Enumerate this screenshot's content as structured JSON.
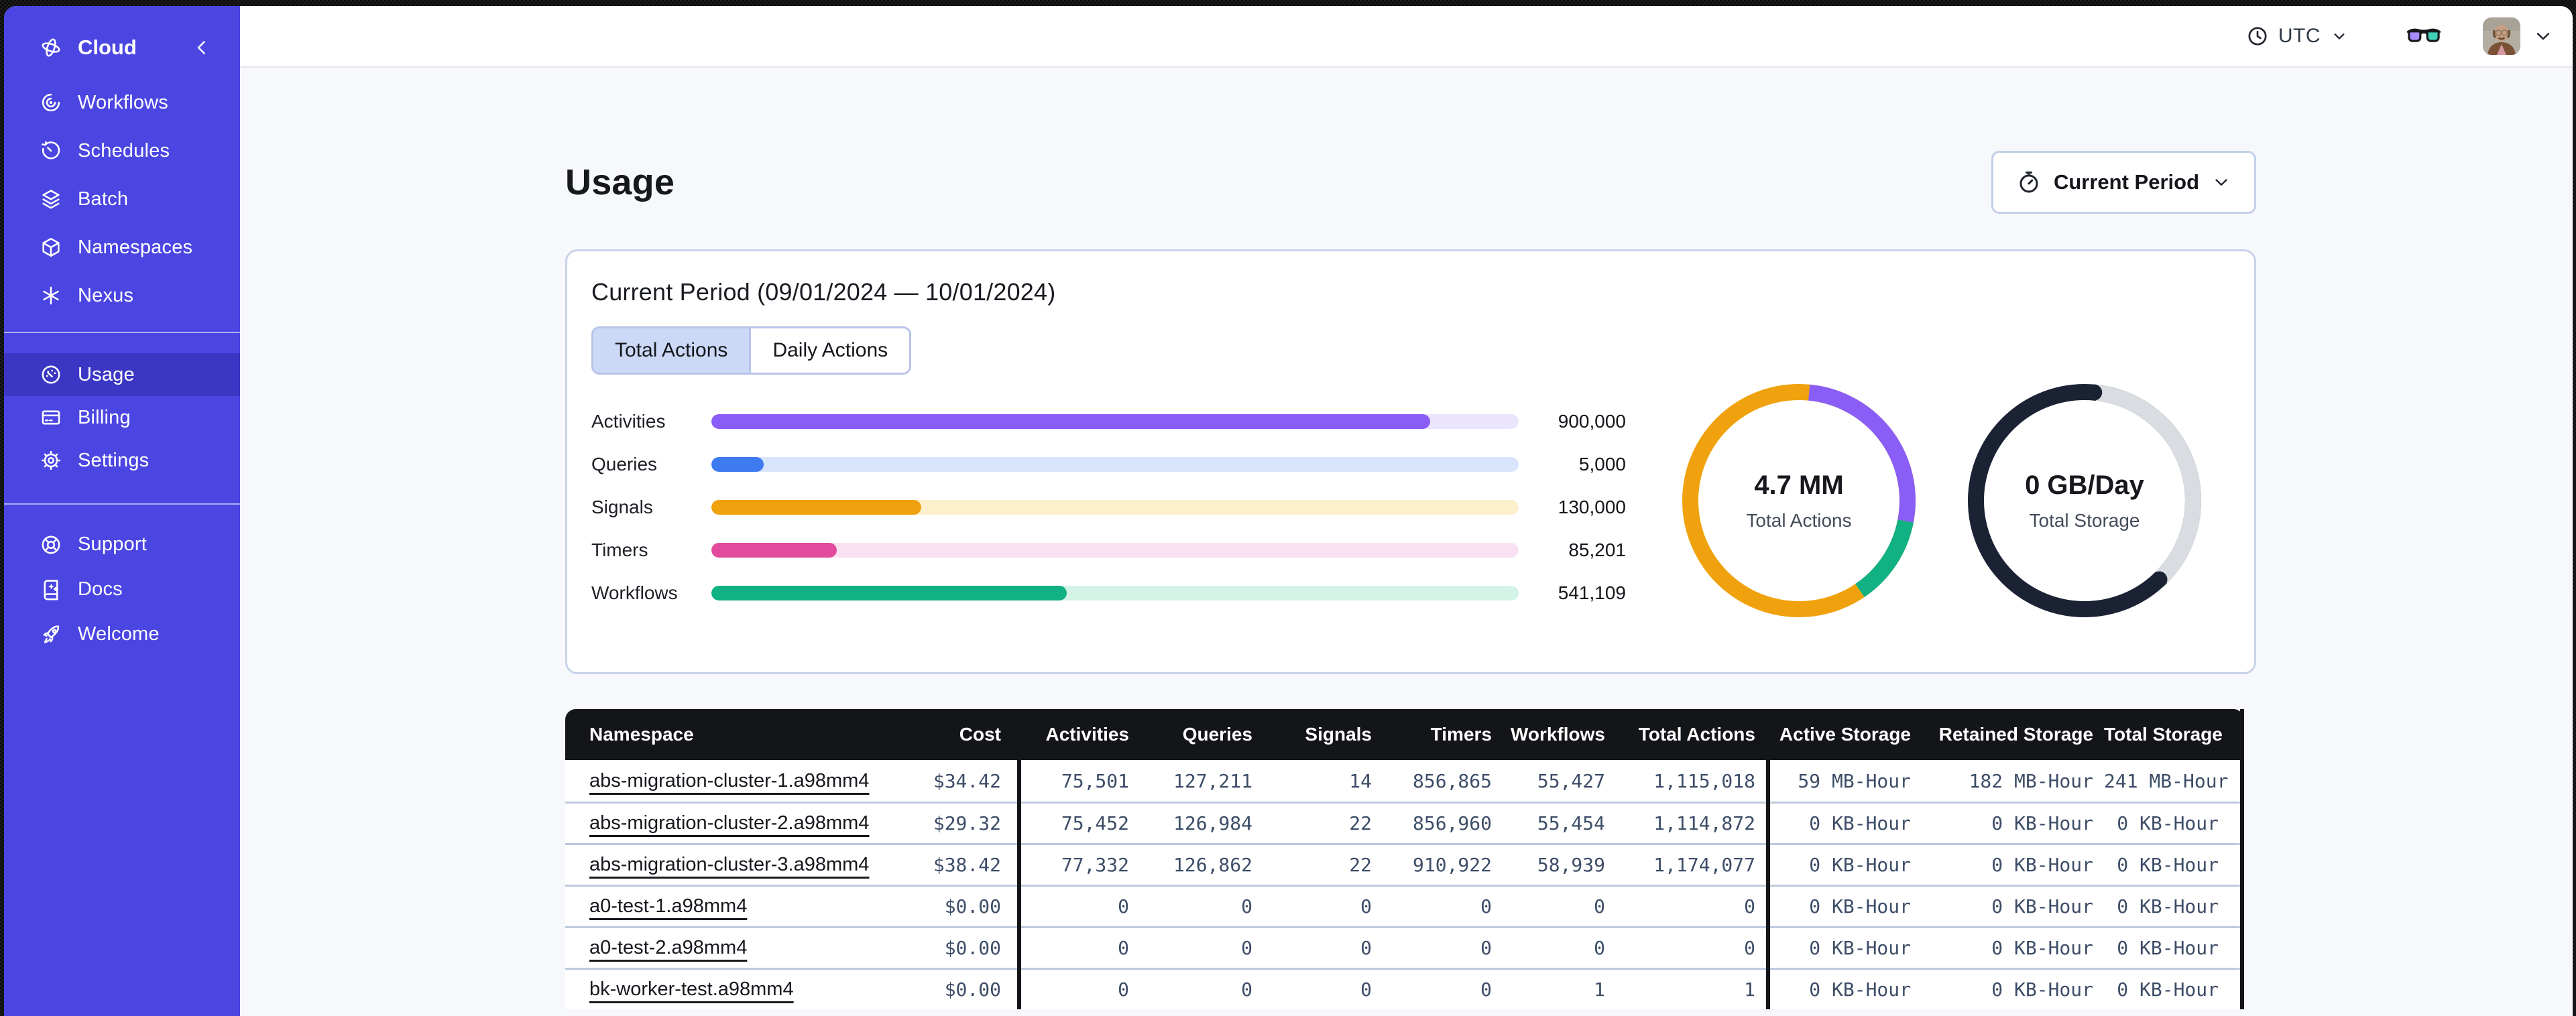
{
  "sidebar": {
    "brand": {
      "label": "Cloud",
      "icon": "temporal-logo-icon"
    },
    "nav_main": [
      {
        "label": "Workflows",
        "icon": "workflows-icon"
      },
      {
        "label": "Schedules",
        "icon": "schedules-icon"
      },
      {
        "label": "Batch",
        "icon": "batch-icon"
      },
      {
        "label": "Namespaces",
        "icon": "namespaces-icon"
      },
      {
        "label": "Nexus",
        "icon": "nexus-icon"
      }
    ],
    "nav_account": [
      {
        "label": "Usage",
        "icon": "usage-gauge-icon",
        "selected": true
      },
      {
        "label": "Billing",
        "icon": "billing-card-icon",
        "selected": false
      },
      {
        "label": "Settings",
        "icon": "settings-gear-icon",
        "selected": false
      }
    ],
    "nav_footer": [
      {
        "label": "Support",
        "icon": "support-lifebuoy-icon"
      },
      {
        "label": "Docs",
        "icon": "docs-book-icon"
      },
      {
        "label": "Welcome",
        "icon": "welcome-rocket-icon"
      }
    ],
    "bg_color": "#4b46e2",
    "selected_bg_color": "#3b37c4"
  },
  "topbar": {
    "timezone_label": "UTC",
    "icons": [
      "clock-icon",
      "chevron-down-icon",
      "glasses-icon",
      "avatar",
      "chevron-down-icon"
    ]
  },
  "page": {
    "title": "Usage",
    "period_button_label": "Current Period"
  },
  "panel": {
    "title": "Current Period (09/01/2024 — 10/01/2024)",
    "tabs": [
      {
        "label": "Total Actions",
        "selected": true
      },
      {
        "label": "Daily Actions",
        "selected": false
      }
    ]
  },
  "chart_data": [
    {
      "type": "bar",
      "title": "Total Actions by type",
      "categories": [
        "Activities",
        "Queries",
        "Signals",
        "Timers",
        "Workflows"
      ],
      "values": [
        900000,
        5000,
        130000,
        85201,
        541109
      ],
      "display_values": [
        "900,000",
        "5,000",
        "130,000",
        "85,201",
        "541,109"
      ],
      "fill_pct": [
        89,
        6.5,
        26,
        15.5,
        44
      ],
      "colors": [
        "#8a5df6",
        "#3e7bf0",
        "#f0a20e",
        "#e24b9d",
        "#12b183"
      ],
      "track_colors": [
        "#ebe4fd",
        "#d8e5fc",
        "#fcf0cc",
        "#fae1f1",
        "#d3f3e6"
      ],
      "xlim": [
        0,
        1000000
      ],
      "grid": false,
      "legend": "none"
    },
    {
      "type": "donut",
      "center_value": "4.7 MM",
      "center_label": "Total Actions",
      "base_color": "#f0a20e",
      "arcs": [
        {
          "name": "activities",
          "color": "#8a5df6",
          "start": 0.015,
          "frac": 0.265
        },
        {
          "name": "workflows",
          "color": "#12b183",
          "start": 0.28,
          "frac": 0.125
        }
      ],
      "rounded_ends": false
    },
    {
      "type": "donut",
      "center_value": "0 GB/Day",
      "center_label": "Total Storage",
      "base_color": "#1b2234",
      "arcs": [
        {
          "name": "remaining",
          "color": "#d9dce1",
          "start": 0.018,
          "frac": 0.357
        }
      ],
      "rounded_ends": true
    }
  ],
  "table": {
    "columns": [
      "Namespace",
      "Cost",
      "Activities",
      "Queries",
      "Signals",
      "Timers",
      "Workflows",
      "Total Actions",
      "Active Storage",
      "Retained Storage",
      "Total Storage"
    ],
    "rows": [
      [
        "abs-migration-cluster-1.a98mm4",
        "$34.42",
        "75,501",
        "127,211",
        "14",
        "856,865",
        "55,427",
        "1,115,018",
        "59 MB-Hour",
        "182 MB-Hour",
        "241 MB-Hour"
      ],
      [
        "abs-migration-cluster-2.a98mm4",
        "$29.32",
        "75,452",
        "126,984",
        "22",
        "856,960",
        "55,454",
        "1,114,872",
        "0 KB-Hour",
        "0 KB-Hour",
        "0 KB-Hour"
      ],
      [
        "abs-migration-cluster-3.a98mm4",
        "$38.42",
        "77,332",
        "126,862",
        "22",
        "910,922",
        "58,939",
        "1,174,077",
        "0 KB-Hour",
        "0 KB-Hour",
        "0 KB-Hour"
      ],
      [
        "a0-test-1.a98mm4",
        "$0.00",
        "0",
        "0",
        "0",
        "0",
        "0",
        "0",
        "0 KB-Hour",
        "0 KB-Hour",
        "0 KB-Hour"
      ],
      [
        "a0-test-2.a98mm4",
        "$0.00",
        "0",
        "0",
        "0",
        "0",
        "0",
        "0",
        "0 KB-Hour",
        "0 KB-Hour",
        "0 KB-Hour"
      ],
      [
        "bk-worker-test.a98mm4",
        "$0.00",
        "0",
        "0",
        "0",
        "0",
        "1",
        "1",
        "0 KB-Hour",
        "0 KB-Hour",
        "0 KB-Hour"
      ]
    ],
    "header_bg": "#141519",
    "separator_color": "#bccade"
  }
}
